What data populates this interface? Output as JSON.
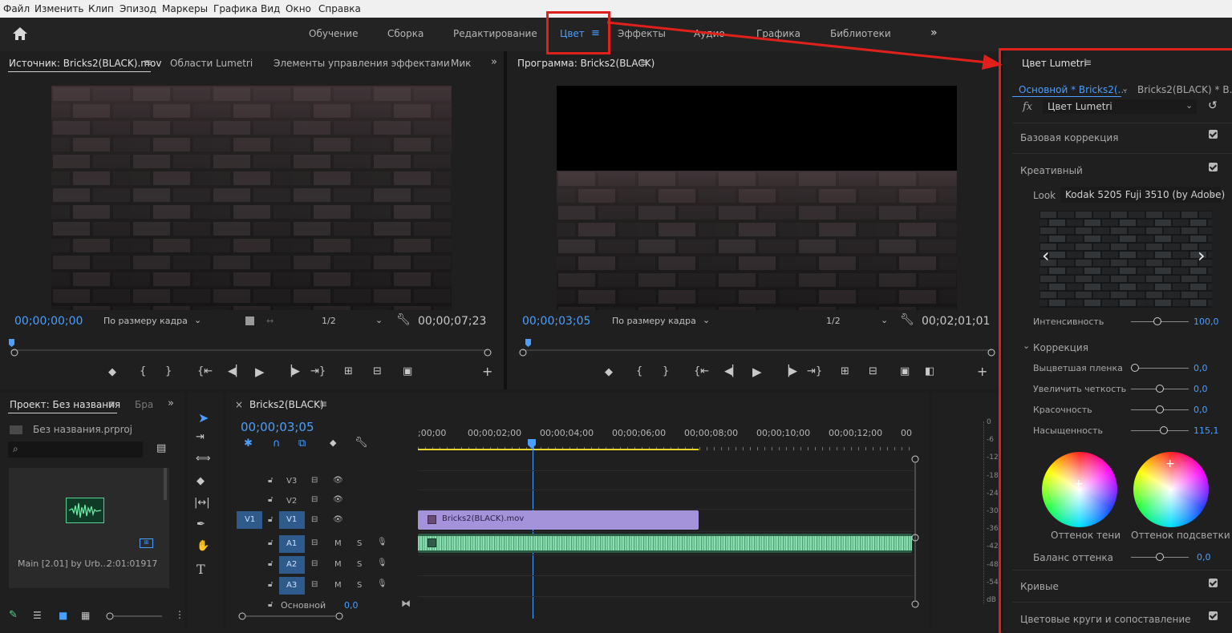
{
  "menu": [
    "Файл",
    "Изменить",
    "Клип",
    "Эпизод",
    "Маркеры",
    "Графика",
    "Вид",
    "Окно",
    "Справка"
  ],
  "workspaces": [
    "Обучение",
    "Сборка",
    "Редактирование",
    "Цвет",
    "Эффекты",
    "Аудио",
    "Графика",
    "Библиотеки"
  ],
  "workspace_more": "»",
  "source_panel": {
    "tabs": [
      "Источник: Bricks2(BLACK).mov",
      "Области Lumetri",
      "Элементы управления эффектами",
      "Мик"
    ],
    "more": "»",
    "timecode": "00;00;00;00",
    "fit": "По размеру кадра",
    "resolution": "1/2",
    "duration": "00;00;07;23"
  },
  "program_panel": {
    "title": "Программа: Bricks2(BLACK)",
    "timecode": "00;00;03;05",
    "fit": "По размеру кадра",
    "resolution": "1/2",
    "duration": "00;02;01;01"
  },
  "project_panel": {
    "title": "Проект: Без названия",
    "tab2": "Бра",
    "more": "»",
    "file": "Без названия.prproj",
    "clip_name": "Main [2.01] by Urb...",
    "clip_duration": "2:01:01917"
  },
  "timeline": {
    "close": "×",
    "sequence": "Bricks2(BLACK)",
    "timecode": "00;00;03;05",
    "ruler": [
      ";00;00",
      "00;00;02;00",
      "00;00;04;00",
      "00;00;06;00",
      "00;00;08;00",
      "00;00;10;00",
      "00;00;12;00",
      "00"
    ],
    "tracks_video": [
      "V3",
      "V2",
      "V1"
    ],
    "source_patch": "V1",
    "tracks_audio": [
      "A1",
      "A2",
      "A3"
    ],
    "mute": "M",
    "solo": "S",
    "master_label": "Основной",
    "master_value": "0,0",
    "clip_label": "Bricks2(BLACK).mov"
  },
  "meter_ticks": [
    "0",
    "-6",
    "-12",
    "-18",
    "-24",
    "-30",
    "-36",
    "-42",
    "-48",
    "-54",
    "dB"
  ],
  "lumetri": {
    "title": "Цвет Lumetri",
    "source_master": "Основной * Bricks2(...",
    "source_clip": "Bricks2(BLACK) * B...",
    "fx_label": "fx",
    "effect": "Цвет Lumetri",
    "sections": {
      "basic": "Базовая коррекция",
      "creative": "Креативный",
      "curves": "Кривые",
      "wheels": "Цветовые круги и сопоставление"
    },
    "look_label": "Look",
    "look_value": "Kodak 5205 Fuji 3510 (by Adobe)",
    "intensity_label": "Интенсивность",
    "intensity": "100,0",
    "intensity_level": 0.45,
    "correction_label": "Коррекция",
    "params": [
      {
        "label": "Выцветшая пленка",
        "value": "0,0",
        "level": 0.0
      },
      {
        "label": "Увеличить четкость",
        "value": "0,0",
        "level": 0.5
      },
      {
        "label": "Красочность",
        "value": "0,0",
        "level": 0.5
      },
      {
        "label": "Насыщенность",
        "value": "115,1",
        "level": 0.58
      }
    ],
    "wheel_shadow": "Оттенок тени",
    "wheel_highlight": "Оттенок подсветки",
    "balance_label": "Баланс оттенка",
    "balance_value": "0,0",
    "balance_level": 0.5
  },
  "colors": {
    "accent": "#4a9fff",
    "video_clip": "#a492da",
    "audio_clip": "#7fd4a6",
    "work_area": "#e8d62a",
    "highlight": "#e0201a"
  }
}
